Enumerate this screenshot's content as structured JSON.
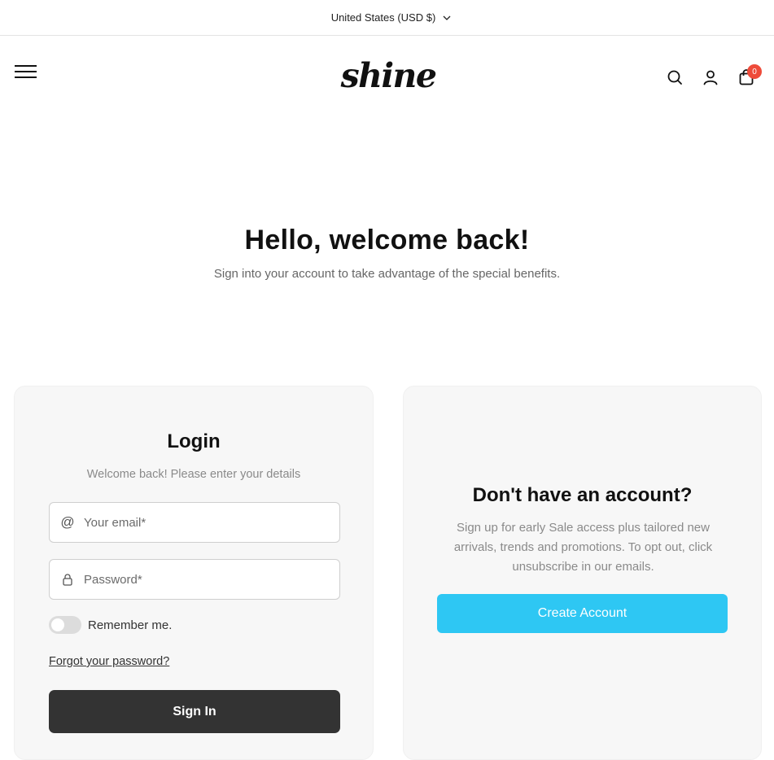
{
  "topbar": {
    "currency_label": "United States (USD $)",
    "chevron_icon": "chevron-down-icon"
  },
  "header": {
    "logo_text": "shine",
    "menu_icon": "hamburger-menu-icon",
    "search_icon": "search-icon",
    "account_icon": "user-icon",
    "cart_icon": "shopping-bag-icon",
    "cart_count": "0"
  },
  "hero": {
    "title": "Hello, welcome back!",
    "subtitle": "Sign into your account to take advantage of the special benefits."
  },
  "login": {
    "title": "Login",
    "subtitle": "Welcome back! Please enter your details",
    "email_placeholder": "Your email*",
    "email_icon": "at-sign-icon",
    "password_placeholder": "Password*",
    "password_icon": "lock-icon",
    "remember_label": "Remember me.",
    "remember_checked": false,
    "forgot_label": "Forgot your password?",
    "signin_label": "Sign In"
  },
  "register": {
    "title": "Don't have an account?",
    "description": "Sign up for early Sale access plus tailored new arrivals, trends and promotions. To opt out, click unsubscribe in our emails.",
    "create_label": "Create Account"
  },
  "colors": {
    "accent": "#2ec7f3",
    "dark_button": "#333333",
    "badge": "#ee4b3a",
    "card_bg": "#f7f7f7"
  }
}
